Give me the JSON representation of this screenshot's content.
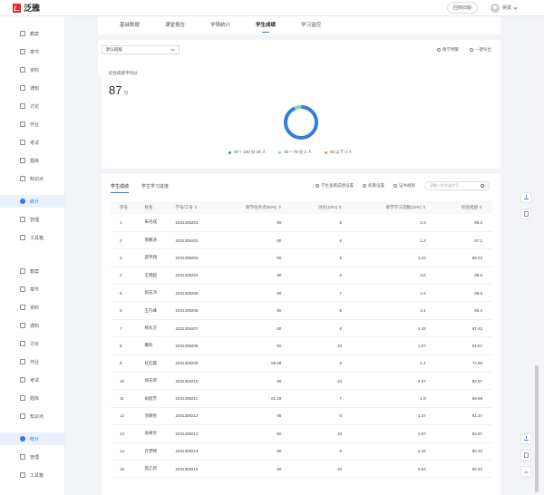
{
  "header": {
    "logo_text": "泛雅",
    "return_button": "回到旧版",
    "username": "吴斌"
  },
  "sidebar": {
    "items": [
      {
        "label": "教案",
        "icon": "doc-icon",
        "active": false
      },
      {
        "label": "章节",
        "icon": "chapter-icon",
        "active": false
      },
      {
        "label": "资料",
        "icon": "folder-icon",
        "active": false
      },
      {
        "label": "通知",
        "icon": "bell-icon",
        "active": false
      },
      {
        "label": "讨论",
        "icon": "chat-icon",
        "active": false
      },
      {
        "label": "作业",
        "icon": "homework-icon",
        "active": false
      },
      {
        "label": "考试",
        "icon": "exam-icon",
        "active": false
      },
      {
        "label": "题库",
        "icon": "bank-icon",
        "active": false
      },
      {
        "label": "知识点",
        "icon": "knowledge-icon",
        "active": false
      },
      {
        "label": "统计",
        "icon": "stats-icon",
        "active": true
      },
      {
        "label": "管理",
        "icon": "gear-icon",
        "active": false
      },
      {
        "label": "工具箱",
        "icon": "toolbox-icon",
        "active": false
      },
      {
        "label": "教案",
        "icon": "doc-icon",
        "active": false
      },
      {
        "label": "章节",
        "icon": "chapter-icon",
        "active": false
      },
      {
        "label": "资料",
        "icon": "folder-icon",
        "active": false
      },
      {
        "label": "通知",
        "icon": "bell-icon",
        "active": false
      },
      {
        "label": "讨论",
        "icon": "chat-icon",
        "active": false
      },
      {
        "label": "作业",
        "icon": "homework-icon",
        "active": false
      },
      {
        "label": "考试",
        "icon": "exam-icon",
        "active": false
      },
      {
        "label": "题库",
        "icon": "bank-icon",
        "active": false
      },
      {
        "label": "知识点",
        "icon": "knowledge-icon",
        "active": false
      },
      {
        "label": "统计",
        "icon": "stats-icon",
        "active": true
      },
      {
        "label": "管理",
        "icon": "gear-icon",
        "active": false
      },
      {
        "label": "工具箱",
        "icon": "toolbox-icon",
        "active": false
      }
    ]
  },
  "tabs": [
    {
      "label": "基础数据",
      "active": false
    },
    {
      "label": "课堂报告",
      "active": false
    },
    {
      "label": "学情统计",
      "active": false
    },
    {
      "label": "学生成绩",
      "active": true
    },
    {
      "label": "学习监控",
      "active": false
    }
  ],
  "filter": {
    "class_select": "默认班级",
    "action_preview": "教学预警",
    "action_export": "一键导出"
  },
  "score": {
    "label": "综合成绩平均分",
    "value": "87",
    "unit": "分",
    "legend": [
      {
        "text": "80 ~ 100 分 28 人",
        "color": "#2f7de1",
        "count": 28
      },
      {
        "text": "60 ~ 79 分 2 人",
        "color": "#7ed9b3",
        "count": 2
      },
      {
        "text": "59 以下     0 人",
        "color": "#f08c3a",
        "count": 0
      }
    ]
  },
  "table_tabs": [
    {
      "label": "学生成绩",
      "active": true
    },
    {
      "label": "学生学习进度",
      "active": false
    }
  ],
  "table_actions": {
    "weight_view": "学生查看成绩设置",
    "weight_set": "权重设置",
    "rule": "证书规则",
    "search_placeholder": "请输入姓名或学号"
  },
  "table": {
    "headers": [
      "序号",
      "姓名",
      "学号/工号 ⇕",
      "章节任务点(60%) ⇕",
      "讨论(10%) ⇕",
      "章节学习次数(10%) ⇕",
      "综合成绩 ⇕"
    ],
    "rows": [
      [
        "1",
        "朱丹成",
        "2031305201",
        "80",
        "6",
        "2.3",
        "88.3"
      ],
      [
        "2",
        "郭鹏浩",
        "2031309202",
        "80",
        "6",
        "1.2",
        "87.2"
      ],
      [
        "3",
        "邵宇翔",
        "2031309203",
        "80",
        "5",
        "1.23",
        "86.23"
      ],
      [
        "4",
        "王晓超",
        "2031309204",
        "80",
        "6",
        "3.6",
        "89.6"
      ],
      [
        "5",
        "闵志鸿",
        "2031309205",
        "80",
        "7",
        "1.8",
        "88.8"
      ],
      [
        "6",
        "王乃峰",
        "2031309206",
        "80",
        "8",
        "2.4",
        "90.4"
      ],
      [
        "7",
        "杨东方",
        "2031309207",
        "80",
        "6",
        "1.43",
        "87.43"
      ],
      [
        "8",
        "魏科",
        "2031309208",
        "80",
        "10",
        "1.67",
        "91.67"
      ],
      [
        "9",
        "杜红磊",
        "2031309209",
        "65.88",
        "6",
        "1.1",
        "72.98"
      ],
      [
        "10",
        "郑天荣",
        "2031309210",
        "80",
        "10",
        "2.57",
        "92.57"
      ],
      [
        "11",
        "俞挺芳",
        "2031309211",
        "61.18",
        "7",
        "1.8",
        "69.98"
      ],
      [
        "12",
        "汤静怡",
        "2031309212",
        "80",
        "0",
        "1.37",
        "81.37"
      ],
      [
        "13",
        "张靖文",
        "2031309213",
        "80",
        "10",
        "2.87",
        "92.87"
      ],
      [
        "14",
        "齐梦晴",
        "2031309214",
        "80",
        "8",
        "2.33",
        "90.33"
      ],
      [
        "15",
        "莫乙新",
        "2031309215",
        "80",
        "10",
        "0.83",
        "90.83"
      ]
    ]
  }
}
